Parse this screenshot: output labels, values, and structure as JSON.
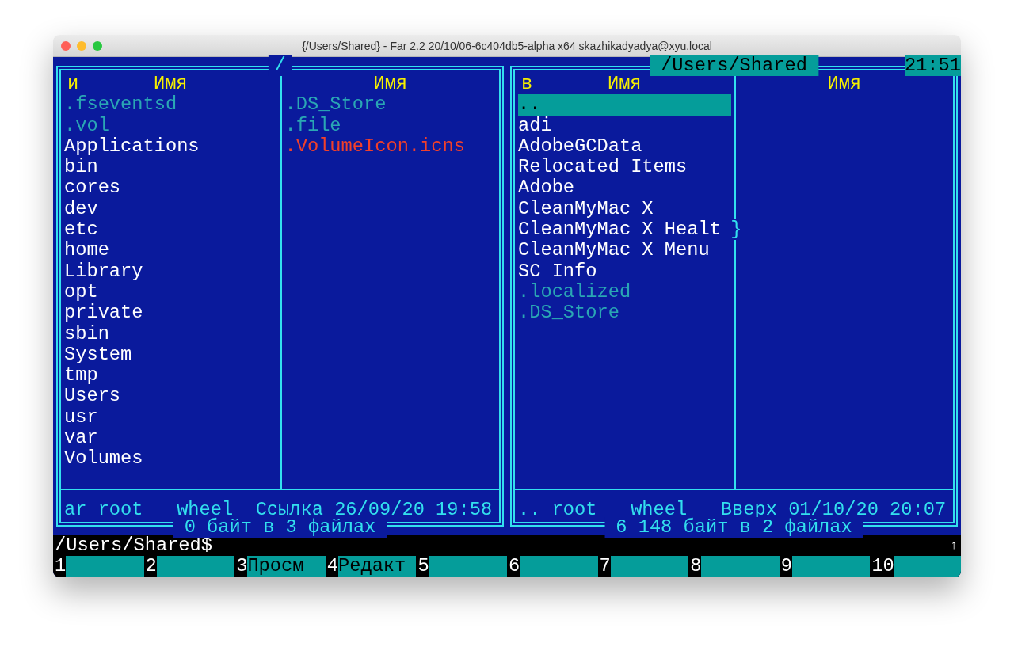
{
  "window": {
    "title": "{/Users/Shared} - Far 2.2 20/10/06-6c404db5-alpha x64 skazhikadyadya@xyu.local"
  },
  "clock": "21:51",
  "panels": [
    {
      "title": "/",
      "active": false,
      "mode_letter": "и",
      "columns": [
        {
          "header": "Имя",
          "files": [
            {
              "name": ".fseventsd",
              "color": "#2aa7b4"
            },
            {
              "name": ".vol",
              "color": "#2aa7b4"
            },
            {
              "name": "Applications",
              "color": "#ffffff"
            },
            {
              "name": "bin",
              "color": "#ffffff"
            },
            {
              "name": "cores",
              "color": "#ffffff"
            },
            {
              "name": "dev",
              "color": "#ffffff"
            },
            {
              "name": "etc",
              "color": "#ffffff"
            },
            {
              "name": "home",
              "color": "#ffffff"
            },
            {
              "name": "Library",
              "color": "#ffffff"
            },
            {
              "name": "opt",
              "color": "#ffffff"
            },
            {
              "name": "private",
              "color": "#ffffff"
            },
            {
              "name": "sbin",
              "color": "#ffffff"
            },
            {
              "name": "System",
              "color": "#ffffff"
            },
            {
              "name": "tmp",
              "color": "#ffffff"
            },
            {
              "name": "Users",
              "color": "#ffffff"
            },
            {
              "name": "usr",
              "color": "#ffffff"
            },
            {
              "name": "var",
              "color": "#ffffff"
            },
            {
              "name": "Volumes",
              "color": "#ffffff"
            }
          ]
        },
        {
          "header": "Имя",
          "files": [
            {
              "name": ".DS_Store",
              "color": "#2aa7b4"
            },
            {
              "name": ".file",
              "color": "#2aa7b4"
            },
            {
              "name": ".VolumeIcon.icns",
              "color": "#f2402a"
            }
          ]
        }
      ],
      "status": "ar root   wheel  Ссылка 26/09/20 19:58",
      "summary": " 0 байт в 3 файлах "
    },
    {
      "title": " /Users/Shared ",
      "active": true,
      "mode_letter": "в",
      "columns": [
        {
          "header": "Имя",
          "files": [
            {
              "name": "..",
              "selected": true
            },
            {
              "name": "adi",
              "color": "#ffffff",
              "selected": false
            },
            {
              "name": "AdobeGCData",
              "color": "#ffffff",
              "selected": false
            },
            {
              "name": "Relocated Items",
              "color": "#ffffff",
              "selected": false
            },
            {
              "name": "Adobe",
              "color": "#ffffff",
              "selected": false
            },
            {
              "name": "CleanMyMac X",
              "color": "#ffffff",
              "selected": false
            },
            {
              "name": "CleanMyMac X Healt",
              "overflow_mark": "}",
              "color": "#ffffff",
              "selected": false
            },
            {
              "name": "CleanMyMac X Menu",
              "color": "#ffffff",
              "selected": false
            },
            {
              "name": "SC Info",
              "color": "#ffffff",
              "selected": false
            },
            {
              "name": ".localized",
              "color": "#2aa7b4",
              "selected": false
            },
            {
              "name": ".DS_Store",
              "color": "#2aa7b4",
              "selected": false
            }
          ]
        },
        {
          "header": "Имя"
        }
      ],
      "status": ".. root   wheel   Вверх 01/10/20 20:07",
      "summary": " 6 148 байт в 2 файлах "
    }
  ],
  "command_line": {
    "prompt": "/Users/Shared$",
    "scroll_mark": "↑"
  },
  "keybar": [
    {
      "number": "1"
    },
    {
      "number": "2"
    },
    {
      "number": "3",
      "label": "Просм"
    },
    {
      "number": "4",
      "label": "Редакт"
    },
    {
      "number": "5"
    },
    {
      "number": "6"
    },
    {
      "number": "7"
    },
    {
      "number": "8"
    },
    {
      "number": "9"
    },
    {
      "number": "10"
    }
  ]
}
